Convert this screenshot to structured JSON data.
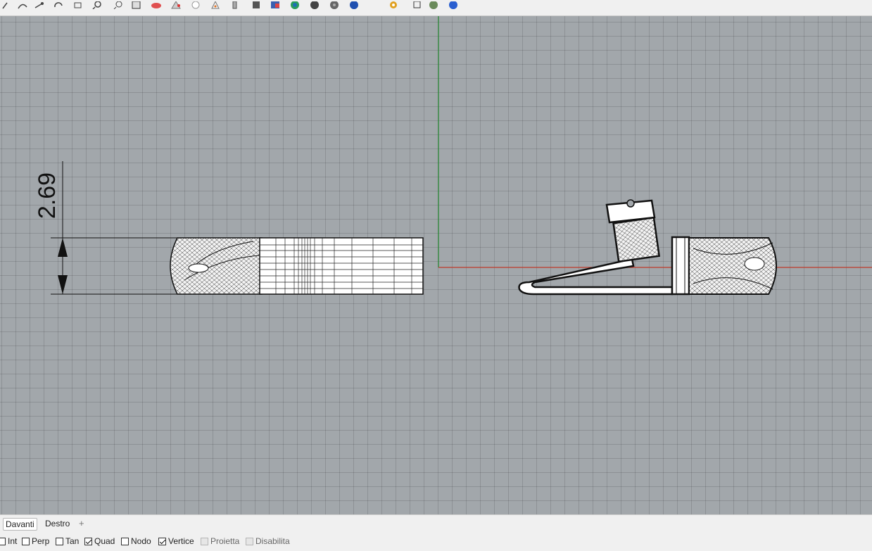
{
  "toolbar": {
    "icons": [
      "polyline-icon",
      "curve-icon",
      "move-icon",
      "rotate-icon",
      "scale-icon",
      "zoom-icon",
      "zoom-window-icon",
      "box-icon",
      "sphere-icon",
      "cone-icon",
      "cylinder-icon",
      "pipe-icon",
      "mesh-icon",
      "shade-icon",
      "color-wheel-icon",
      "render-sphere-icon",
      "material-sphere-icon",
      "blue-sphere-icon",
      "settings-gear-icon",
      "layout-icon",
      "globe-icon",
      "info-icon"
    ]
  },
  "viewport": {
    "dimension": {
      "value": "2.69"
    },
    "axis_colors": {
      "x": "#c0392b",
      "y": "#2e8b3a"
    },
    "background": "#a2a7ab"
  },
  "tabs": [
    {
      "label": "Davanti",
      "active": true
    },
    {
      "label": "Destro",
      "active": false
    }
  ],
  "add_tab": "+",
  "osnaps": [
    {
      "label": "Int",
      "checked": false,
      "enabled": true
    },
    {
      "label": "Perp",
      "checked": false,
      "enabled": true
    },
    {
      "label": "Tan",
      "checked": false,
      "enabled": true
    },
    {
      "label": "Quad",
      "checked": true,
      "enabled": true
    },
    {
      "label": "Nodo",
      "checked": false,
      "enabled": true
    },
    {
      "label": "Vertice",
      "checked": true,
      "enabled": true
    },
    {
      "label": "Proietta",
      "checked": false,
      "enabled": false
    },
    {
      "label": "Disabilita",
      "checked": false,
      "enabled": false
    }
  ]
}
